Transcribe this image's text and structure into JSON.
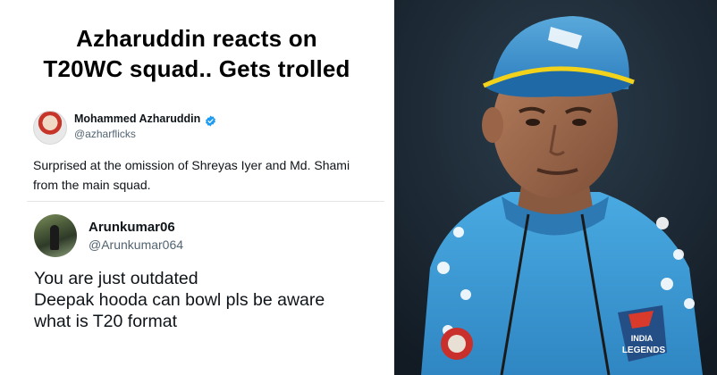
{
  "headline": {
    "line1": "Azharuddin reacts on",
    "line2": "T20WC squad.. Gets trolled"
  },
  "tweet1": {
    "name": "Mohammed Azharuddin",
    "handle": "@azharflicks",
    "verified_icon": "verified-badge-icon",
    "text": "Surprised at the omission of Shreyas Iyer and Md. Shami from the main squad."
  },
  "tweet2": {
    "name": "Arunkumar06",
    "handle": "@Arunkumar064",
    "text_lines": [
      "You are just outdated",
      "Deepak hooda can bowl pls be aware",
      "what is T20 format"
    ]
  },
  "photo": {
    "jersey_logo_line1": "INDIA",
    "jersey_logo_line2": "LEGENDS",
    "colors": {
      "jersey": "#3f9fd8",
      "cap": "#2f86c8",
      "cap_brim_edge": "#f2d21b",
      "background": "#1c2a36"
    }
  },
  "colors": {
    "verified": "#1d9bf0",
    "text_primary": "#0f1419",
    "text_secondary": "#536471"
  }
}
